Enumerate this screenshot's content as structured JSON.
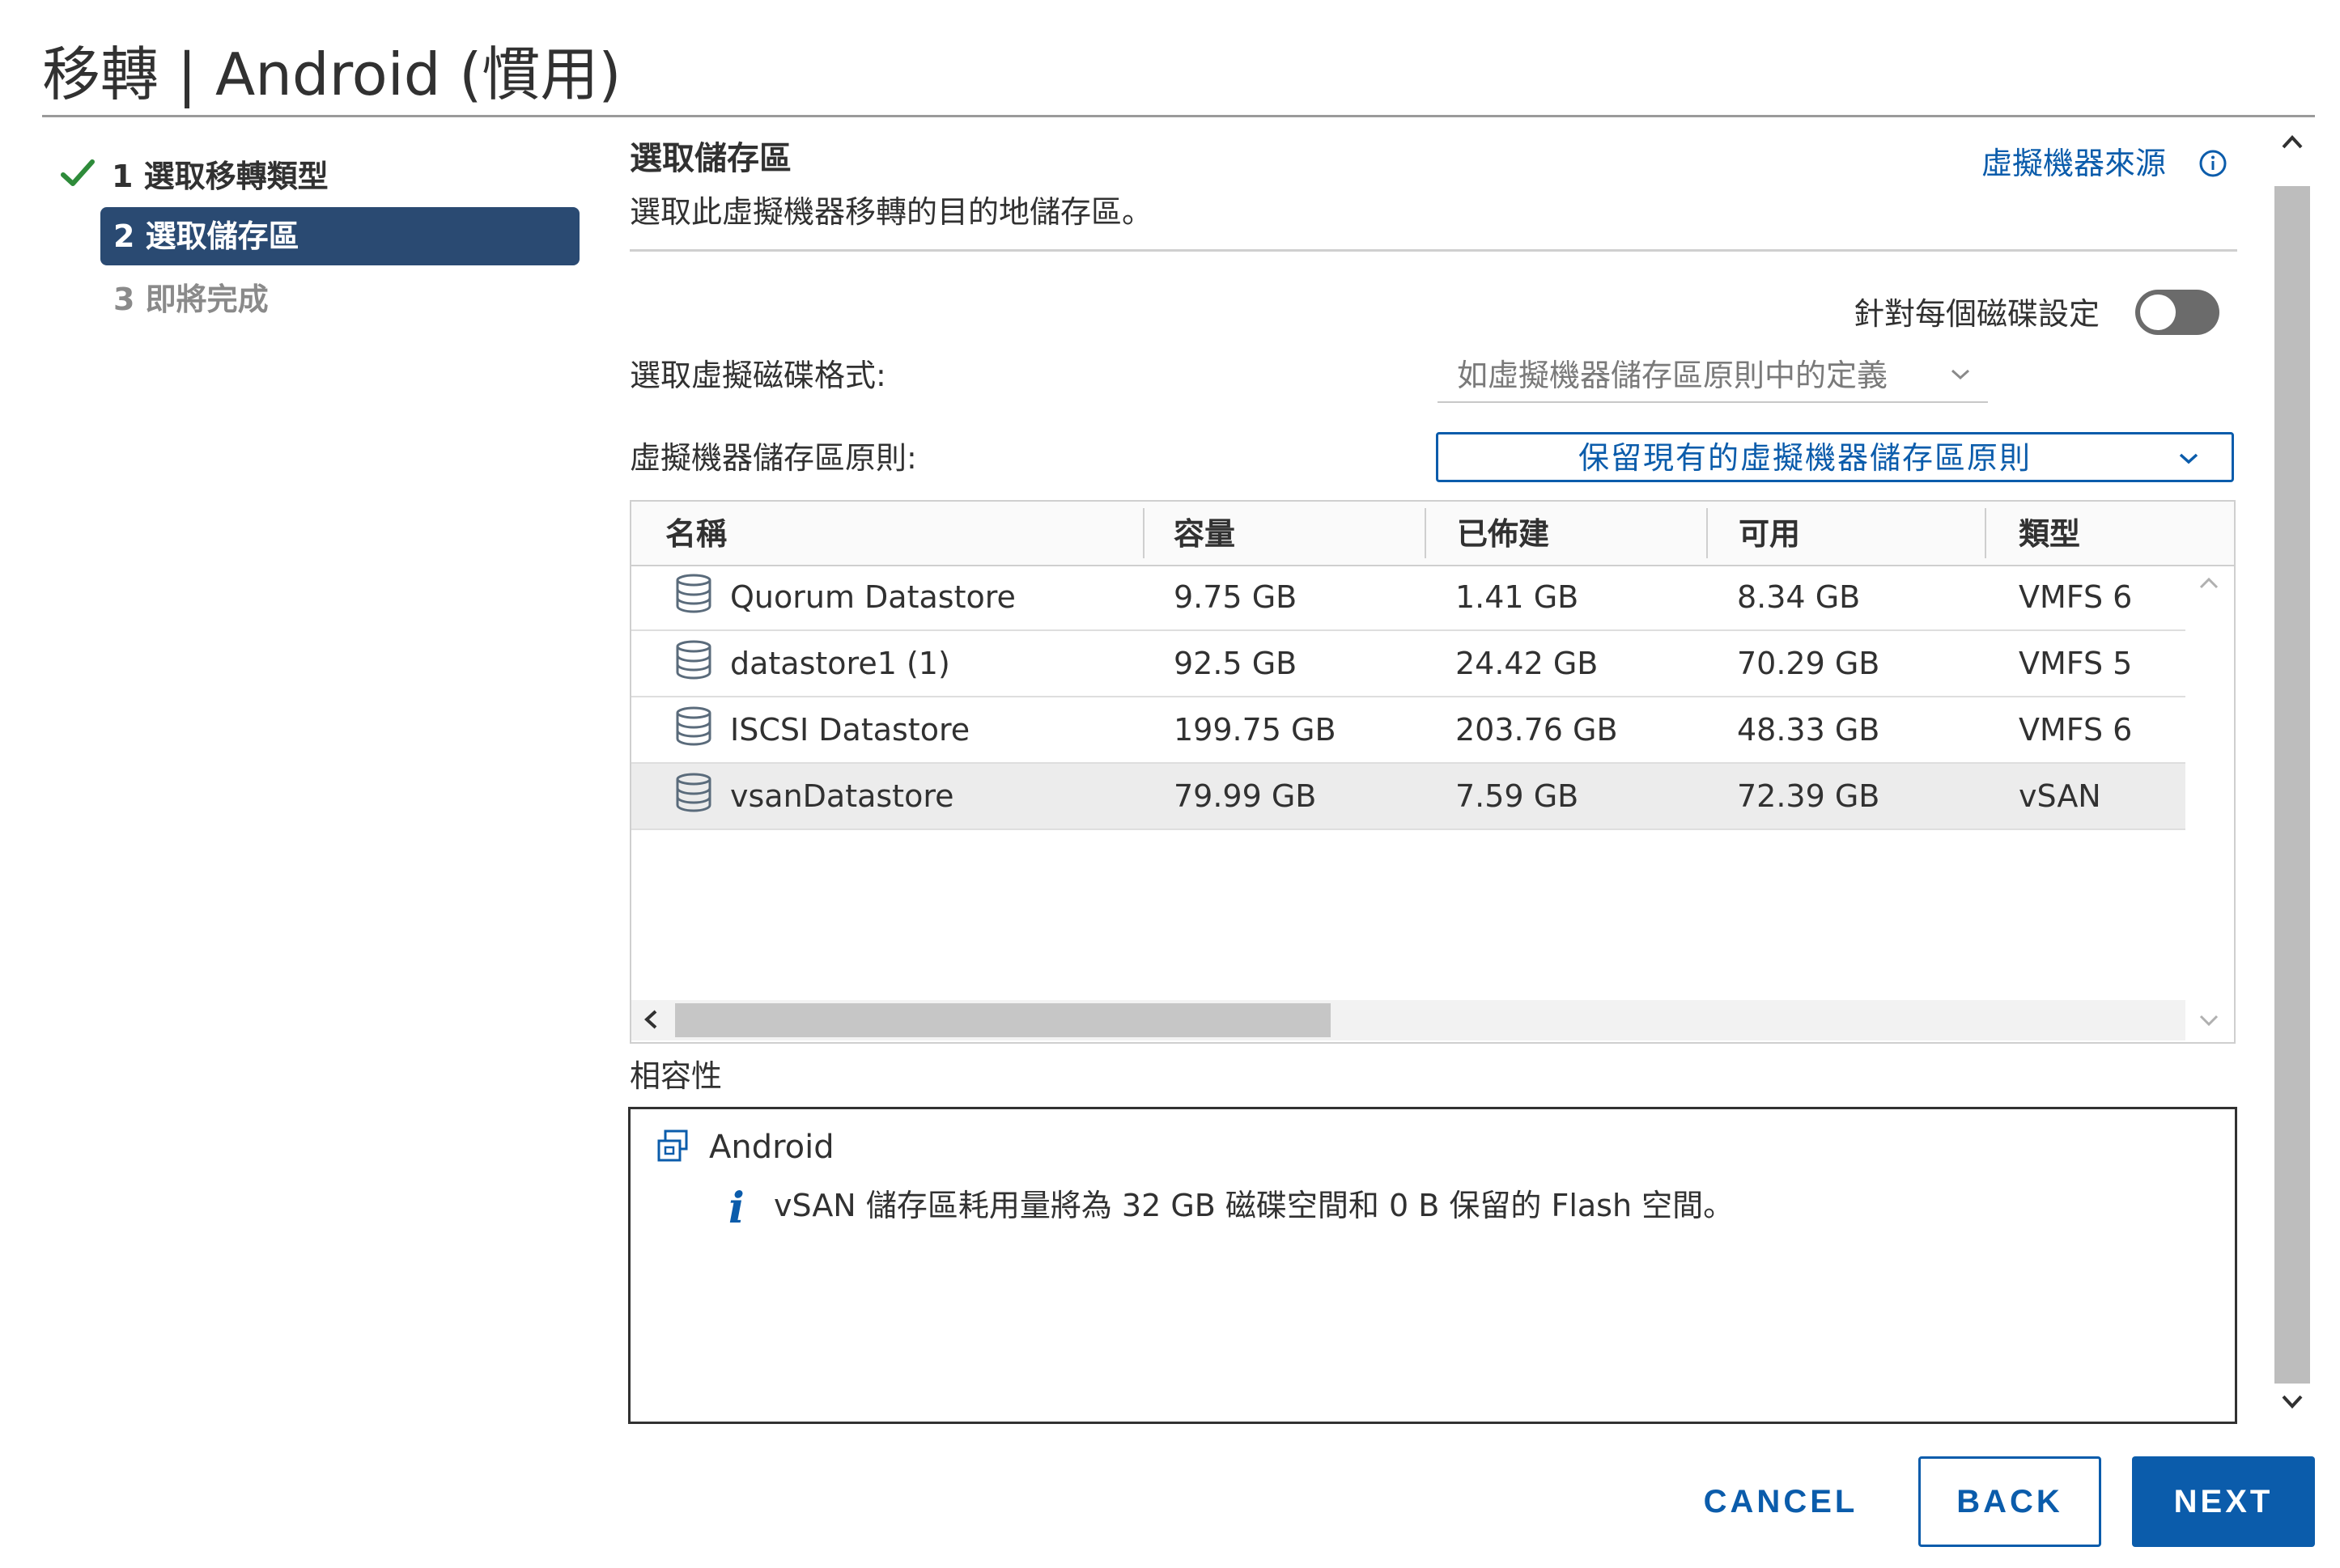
{
  "window": {
    "title": "移轉 | Android (慣用)"
  },
  "steps": [
    {
      "label": "1 選取移轉類型",
      "state": "done"
    },
    {
      "label": "2 選取儲存區",
      "state": "active"
    },
    {
      "label": "3 即將完成",
      "state": "pending"
    }
  ],
  "content": {
    "heading": "選取儲存區",
    "subheading": "選取此虛擬機器移轉的目的地儲存區。",
    "vm_origin_link": "虛擬機器來源",
    "per_disk_label": "針對每個磁碟設定",
    "per_disk_enabled": false,
    "disk_format_label": "選取虛擬磁碟格式:",
    "disk_format_value": "如虛擬機器儲存區原則中的定義",
    "storage_policy_label": "虛擬機器儲存區原則:",
    "storage_policy_value": "保留現有的虛擬機器儲存區原則"
  },
  "table": {
    "columns": [
      "名稱",
      "容量",
      "已佈建",
      "可用",
      "類型"
    ],
    "rows": [
      {
        "name": "Quorum Datastore",
        "capacity": "9.75 GB",
        "provisioned": "1.41 GB",
        "free": "8.34 GB",
        "type": "VMFS 6",
        "selected": false
      },
      {
        "name": "datastore1 (1)",
        "capacity": "92.5 GB",
        "provisioned": "24.42 GB",
        "free": "70.29 GB",
        "type": "VMFS 5",
        "selected": false
      },
      {
        "name": "ISCSI Datastore",
        "capacity": "199.75 GB",
        "provisioned": "203.76 GB",
        "free": "48.33 GB",
        "type": "VMFS 6",
        "selected": false
      },
      {
        "name": "vsanDatastore",
        "capacity": "79.99 GB",
        "provisioned": "7.59 GB",
        "free": "72.39 GB",
        "type": "vSAN",
        "selected": true
      }
    ]
  },
  "compatibility": {
    "label": "相容性",
    "vm_name": "Android",
    "message": "vSAN 儲存區耗用量將為 32 GB 磁碟空間和 0 B 保留的 Flash 空間。"
  },
  "footer": {
    "cancel_label": "CANCEL",
    "back_label": "BACK",
    "next_label": "NEXT"
  },
  "colors": {
    "accent": "#0b5cab",
    "active_step_bg": "#2a4a72",
    "success": "#2e8b3a",
    "toggle_off": "#6b6b6b"
  },
  "icons": [
    "check-icon",
    "info-circle-icon",
    "chevron-down-icon",
    "datastore-icon",
    "chevron-left-icon",
    "chevron-up-icon",
    "vm-icon",
    "info-icon"
  ]
}
